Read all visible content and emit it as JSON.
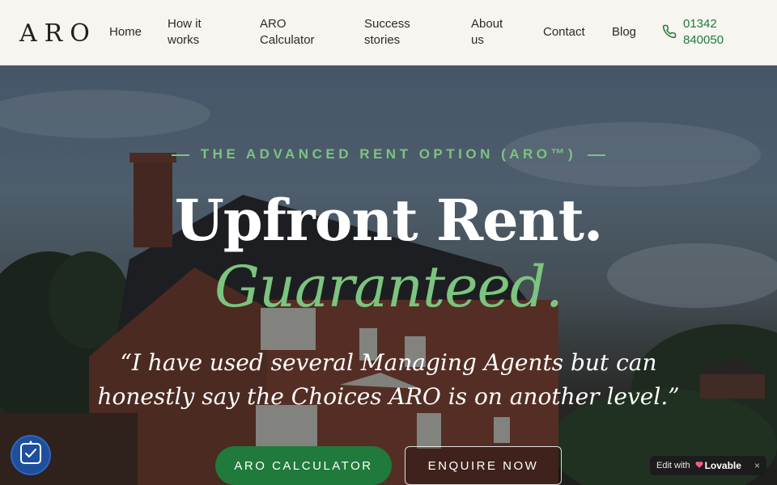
{
  "brand": {
    "logo_text": "ARO"
  },
  "nav": {
    "items": [
      {
        "label": "Home"
      },
      {
        "label": "How it works"
      },
      {
        "label": "ARO Calculator"
      },
      {
        "label": "Success stories"
      },
      {
        "label": "About us"
      },
      {
        "label": "Contact"
      },
      {
        "label": "Blog"
      }
    ],
    "phone": {
      "number": "01342 840050",
      "icon": "phone-icon"
    }
  },
  "hero": {
    "eyebrow": "THE ADVANCED RENT OPTION (ARO™)",
    "title": "Upfront Rent.",
    "title_accent": "Guaranteed.",
    "quote": "“I have used several Managing Agents but can honestly say the Choices ARO is on another level.”",
    "primary_button": "ARO CALCULATOR",
    "secondary_button": "ENQUIRE NOW"
  },
  "widgets": {
    "accessibility_icon": "accessibility-icon",
    "lovable_badge": {
      "prefix": "Edit with",
      "brand": "Lovable",
      "close": "×"
    }
  },
  "colors": {
    "accent_green": "#1f7a3b",
    "accent_light_green": "#7cc47f",
    "header_bg": "#f7f5f0"
  }
}
